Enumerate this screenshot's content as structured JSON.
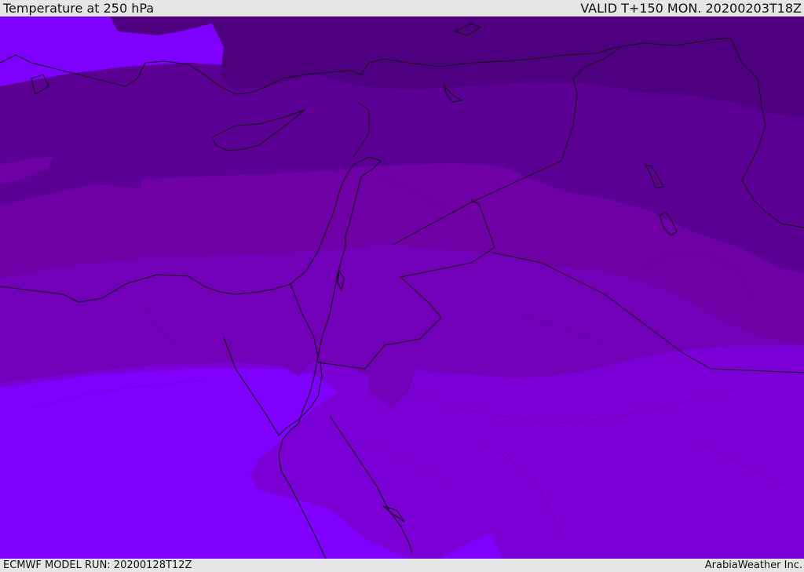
{
  "header": {
    "title": "Temperature at 250 hPa",
    "valid_time": "VALID T+150 MON. 20200203T18Z"
  },
  "footer": {
    "model_run": "ECMWF MODEL RUN: 20200128T12Z",
    "provider": "ArabiaWeather Inc."
  },
  "map": {
    "field": "temperature",
    "pressure_level_hpa": 250,
    "band_colors": [
      "#4e0080",
      "#5c0095",
      "#6e00a6",
      "#7200b8",
      "#7a00d6",
      "#7f00ff"
    ],
    "coastline_color": "#111111",
    "border_color": "#111111"
  }
}
